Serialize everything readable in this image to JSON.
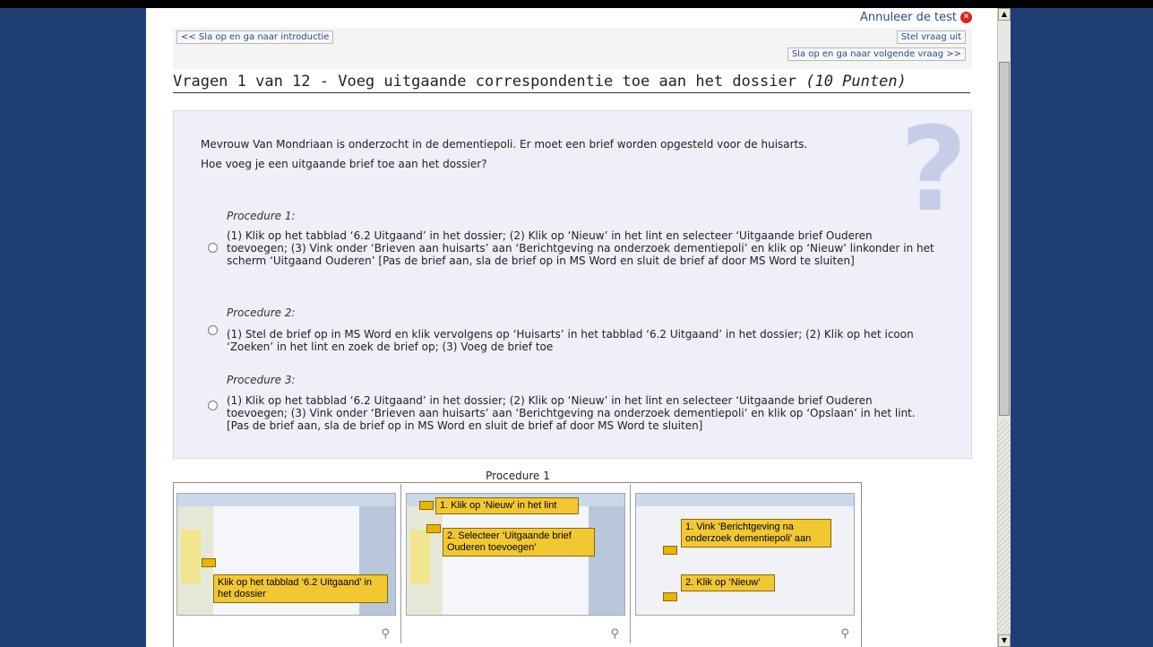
{
  "header": {
    "cancel_label": "Annuleer de test",
    "back_button": "<< Sla op en ga naar introductie",
    "postpone_button": "Stel vraag uit",
    "next_button": "Sla op en ga naar volgende vraag >>"
  },
  "question": {
    "title": "Vragen 1 van 12 - Voeg uitgaande correspondentie toe aan het dossier",
    "points": "(10 Punten)",
    "intro_line1": "Mevrouw Van Mondriaan is onderzocht in de dementiepoli. Er moet een brief worden opgesteld voor de huisarts.",
    "intro_line2": "Hoe voeg je een uitgaande brief toe aan het dossier?",
    "options": [
      {
        "label": "Procedure 1:",
        "text": "(1) Klik op het tabblad ‘6.2 Uitgaand’ in het dossier; (2) Klik op ‘Nieuw’ in het lint en selecteer ‘Uitgaande brief Ouderen toevoegen; (3) Vink onder ‘Brieven aan huisarts’ aan ‘Berichtgeving na onderzoek dementiepoli’ en klik op ‘Nieuw’ linkonder in het scherm ‘Uitgaand Ouderen’ [Pas de brief aan, sla de brief op in MS Word en sluit de brief af door MS Word te sluiten]"
      },
      {
        "label": "Procedure 2:",
        "text": "(1) Stel de brief op in MS Word en klik vervolgens op ‘Huisarts’ in het tabblad ‘6.2 Uitgaand’ in het dossier; (2) Klik op het icoon ‘Zoeken’ in het lint en zoek de brief op; (3) Voeg de brief toe"
      },
      {
        "label": "Procedure 3:",
        "text": "(1) Klik op het tabblad ‘6.2 Uitgaand’ in het dossier; (2) Klik op ‘Nieuw’ in het lint en selecteer ‘Uitgaande brief Ouderen toevoegen; (3) Vink onder ‘Brieven aan huisarts’ aan ‘Berichtgeving na onderzoek dementiepoli’ en klik op ‘Opslaan’ in het lint. [Pas de brief aan, sla de brief op in MS Word en sluit de brief af door MS Word te sluiten]"
      }
    ]
  },
  "gallery": {
    "title": "Procedure 1",
    "thumbs": [
      {
        "callouts": [
          "Klik op het tabblad ‘6.2 Uitgaand’ in het dossier"
        ]
      },
      {
        "callouts": [
          "1. Klik op ‘Nieuw’ in het lint",
          "2. Selecteer ‘Uitgaande brief Ouderen toevoegen’"
        ]
      },
      {
        "callouts": [
          "1. Vink ‘Berichtgeving na onderzoek dementiepoli’ aan",
          "2. Klik op ‘Nieuw’"
        ]
      }
    ]
  },
  "icons": {
    "cancel": "cancel-icon",
    "question_mark": "question-mark-icon",
    "zoom": "zoom-icon"
  },
  "colors": {
    "background": "#1f3f73",
    "link": "#2a4c8c",
    "callout": "#f2c832",
    "panel": "#eeeff8"
  }
}
